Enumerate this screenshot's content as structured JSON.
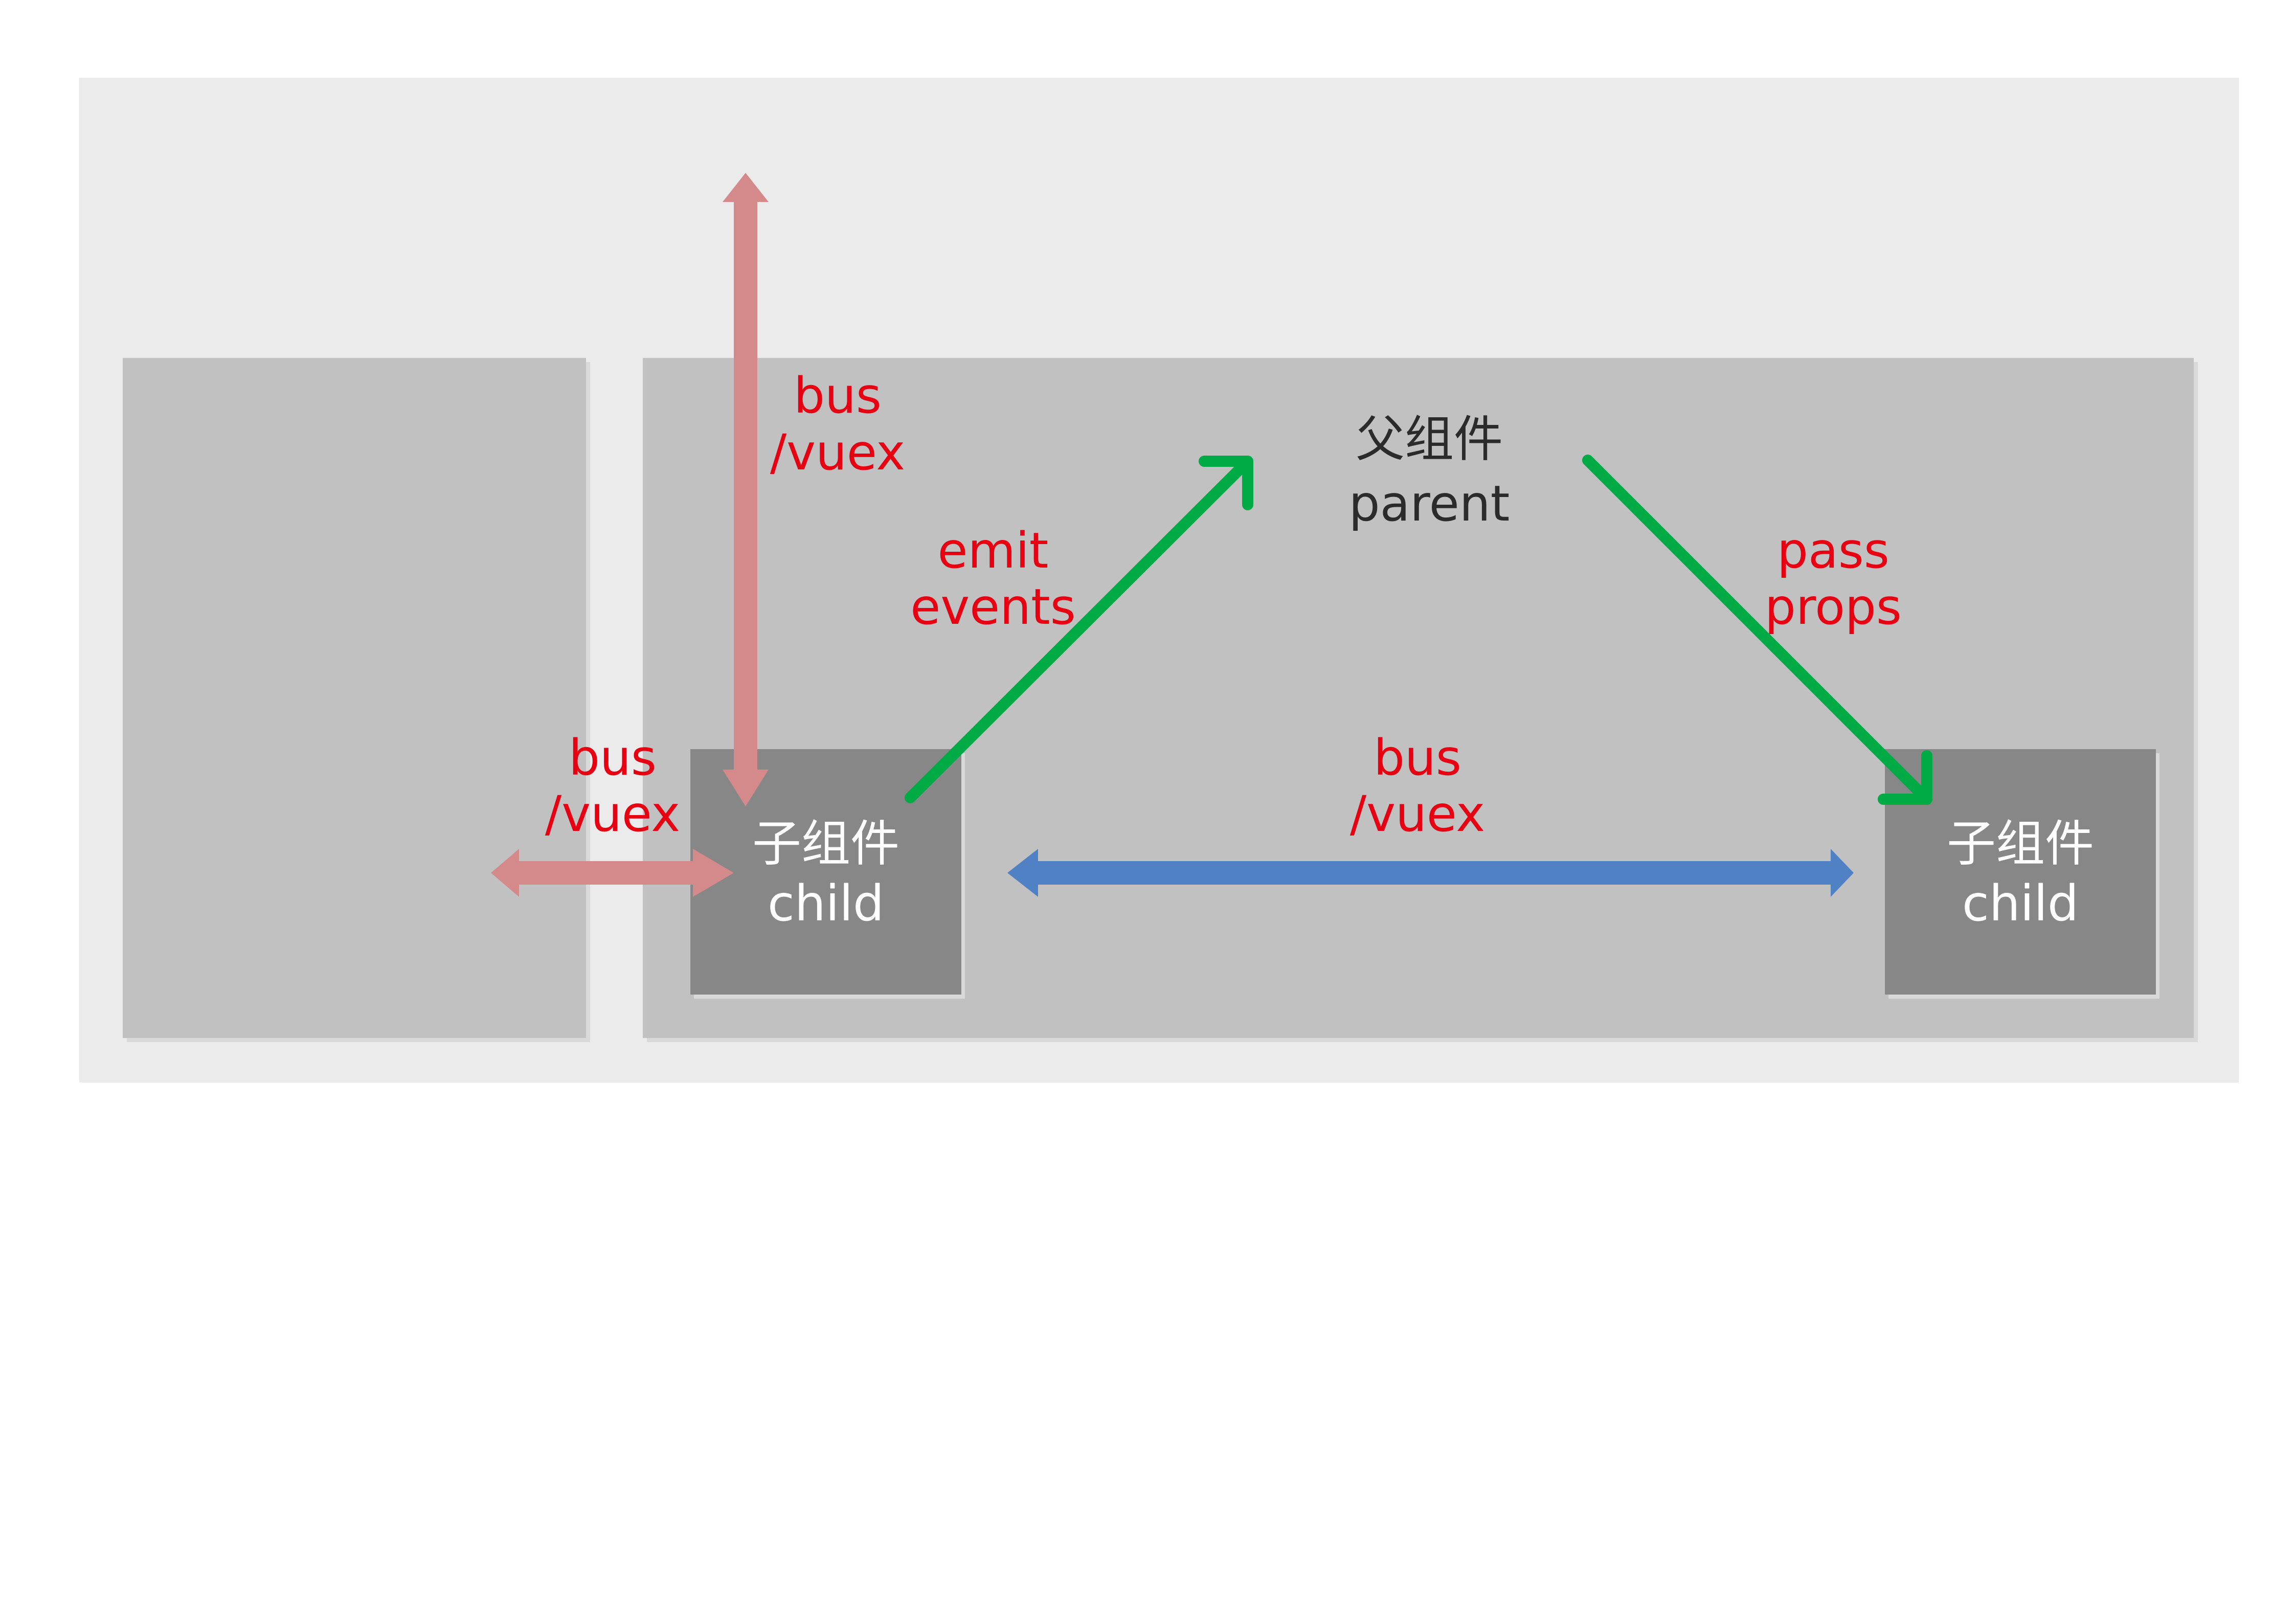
{
  "colors": {
    "page_background": "#ffffff",
    "outer_panel": "#ebebeb",
    "group_panel": "#c1c1c1",
    "child_box": "#878787",
    "panel_shadow": "#d9d9d9",
    "label_red": "#e60012",
    "text_dark": "#2b2b2b",
    "text_light": "#ffffff",
    "arrow_green": "#00aa44",
    "arrow_blue": "#4f81c4",
    "arrow_pink": "#d48a8a"
  },
  "parent": {
    "label_zh": "父组件",
    "label_en": "parent"
  },
  "child_left": {
    "label_zh": "子组件",
    "label_en": "child"
  },
  "child_right": {
    "label_zh": "子组件",
    "label_en": "child"
  },
  "labels": {
    "bus_vertical": {
      "line1": "bus",
      "line2": "/vuex"
    },
    "bus_horizontal_left": {
      "line1": "bus",
      "line2": "/vuex"
    },
    "bus_between_children": {
      "line1": "bus",
      "line2": "/vuex"
    },
    "emit_events": {
      "line1": "emit",
      "line2": "events"
    },
    "pass_props": {
      "line1": "pass",
      "line2": "props"
    }
  }
}
